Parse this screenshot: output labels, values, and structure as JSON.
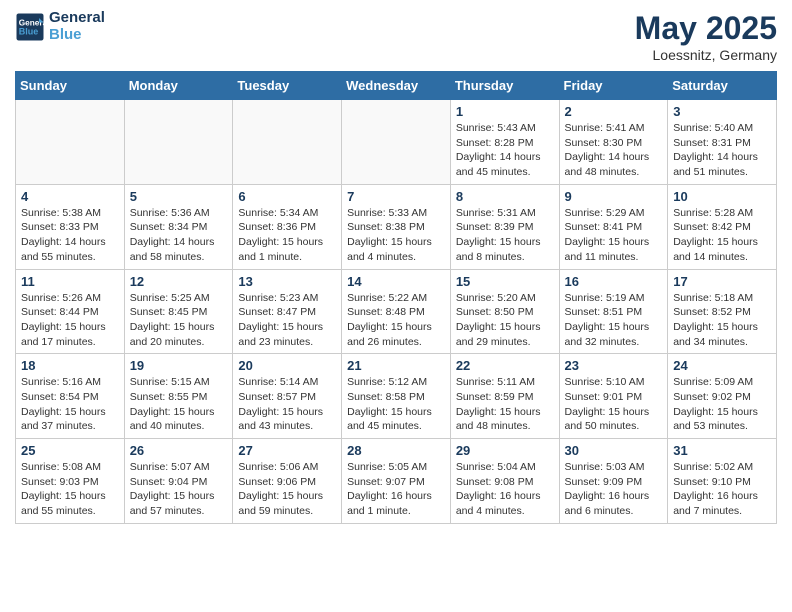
{
  "header": {
    "logo_general": "General",
    "logo_blue": "Blue",
    "month_title": "May 2025",
    "location": "Loessnitz, Germany"
  },
  "weekdays": [
    "Sunday",
    "Monday",
    "Tuesday",
    "Wednesday",
    "Thursday",
    "Friday",
    "Saturday"
  ],
  "weeks": [
    [
      {
        "day": "",
        "info": ""
      },
      {
        "day": "",
        "info": ""
      },
      {
        "day": "",
        "info": ""
      },
      {
        "day": "",
        "info": ""
      },
      {
        "day": "1",
        "info": "Sunrise: 5:43 AM\nSunset: 8:28 PM\nDaylight: 14 hours\nand 45 minutes."
      },
      {
        "day": "2",
        "info": "Sunrise: 5:41 AM\nSunset: 8:30 PM\nDaylight: 14 hours\nand 48 minutes."
      },
      {
        "day": "3",
        "info": "Sunrise: 5:40 AM\nSunset: 8:31 PM\nDaylight: 14 hours\nand 51 minutes."
      }
    ],
    [
      {
        "day": "4",
        "info": "Sunrise: 5:38 AM\nSunset: 8:33 PM\nDaylight: 14 hours\nand 55 minutes."
      },
      {
        "day": "5",
        "info": "Sunrise: 5:36 AM\nSunset: 8:34 PM\nDaylight: 14 hours\nand 58 minutes."
      },
      {
        "day": "6",
        "info": "Sunrise: 5:34 AM\nSunset: 8:36 PM\nDaylight: 15 hours\nand 1 minute."
      },
      {
        "day": "7",
        "info": "Sunrise: 5:33 AM\nSunset: 8:38 PM\nDaylight: 15 hours\nand 4 minutes."
      },
      {
        "day": "8",
        "info": "Sunrise: 5:31 AM\nSunset: 8:39 PM\nDaylight: 15 hours\nand 8 minutes."
      },
      {
        "day": "9",
        "info": "Sunrise: 5:29 AM\nSunset: 8:41 PM\nDaylight: 15 hours\nand 11 minutes."
      },
      {
        "day": "10",
        "info": "Sunrise: 5:28 AM\nSunset: 8:42 PM\nDaylight: 15 hours\nand 14 minutes."
      }
    ],
    [
      {
        "day": "11",
        "info": "Sunrise: 5:26 AM\nSunset: 8:44 PM\nDaylight: 15 hours\nand 17 minutes."
      },
      {
        "day": "12",
        "info": "Sunrise: 5:25 AM\nSunset: 8:45 PM\nDaylight: 15 hours\nand 20 minutes."
      },
      {
        "day": "13",
        "info": "Sunrise: 5:23 AM\nSunset: 8:47 PM\nDaylight: 15 hours\nand 23 minutes."
      },
      {
        "day": "14",
        "info": "Sunrise: 5:22 AM\nSunset: 8:48 PM\nDaylight: 15 hours\nand 26 minutes."
      },
      {
        "day": "15",
        "info": "Sunrise: 5:20 AM\nSunset: 8:50 PM\nDaylight: 15 hours\nand 29 minutes."
      },
      {
        "day": "16",
        "info": "Sunrise: 5:19 AM\nSunset: 8:51 PM\nDaylight: 15 hours\nand 32 minutes."
      },
      {
        "day": "17",
        "info": "Sunrise: 5:18 AM\nSunset: 8:52 PM\nDaylight: 15 hours\nand 34 minutes."
      }
    ],
    [
      {
        "day": "18",
        "info": "Sunrise: 5:16 AM\nSunset: 8:54 PM\nDaylight: 15 hours\nand 37 minutes."
      },
      {
        "day": "19",
        "info": "Sunrise: 5:15 AM\nSunset: 8:55 PM\nDaylight: 15 hours\nand 40 minutes."
      },
      {
        "day": "20",
        "info": "Sunrise: 5:14 AM\nSunset: 8:57 PM\nDaylight: 15 hours\nand 43 minutes."
      },
      {
        "day": "21",
        "info": "Sunrise: 5:12 AM\nSunset: 8:58 PM\nDaylight: 15 hours\nand 45 minutes."
      },
      {
        "day": "22",
        "info": "Sunrise: 5:11 AM\nSunset: 8:59 PM\nDaylight: 15 hours\nand 48 minutes."
      },
      {
        "day": "23",
        "info": "Sunrise: 5:10 AM\nSunset: 9:01 PM\nDaylight: 15 hours\nand 50 minutes."
      },
      {
        "day": "24",
        "info": "Sunrise: 5:09 AM\nSunset: 9:02 PM\nDaylight: 15 hours\nand 53 minutes."
      }
    ],
    [
      {
        "day": "25",
        "info": "Sunrise: 5:08 AM\nSunset: 9:03 PM\nDaylight: 15 hours\nand 55 minutes."
      },
      {
        "day": "26",
        "info": "Sunrise: 5:07 AM\nSunset: 9:04 PM\nDaylight: 15 hours\nand 57 minutes."
      },
      {
        "day": "27",
        "info": "Sunrise: 5:06 AM\nSunset: 9:06 PM\nDaylight: 15 hours\nand 59 minutes."
      },
      {
        "day": "28",
        "info": "Sunrise: 5:05 AM\nSunset: 9:07 PM\nDaylight: 16 hours\nand 1 minute."
      },
      {
        "day": "29",
        "info": "Sunrise: 5:04 AM\nSunset: 9:08 PM\nDaylight: 16 hours\nand 4 minutes."
      },
      {
        "day": "30",
        "info": "Sunrise: 5:03 AM\nSunset: 9:09 PM\nDaylight: 16 hours\nand 6 minutes."
      },
      {
        "day": "31",
        "info": "Sunrise: 5:02 AM\nSunset: 9:10 PM\nDaylight: 16 hours\nand 7 minutes."
      }
    ]
  ]
}
